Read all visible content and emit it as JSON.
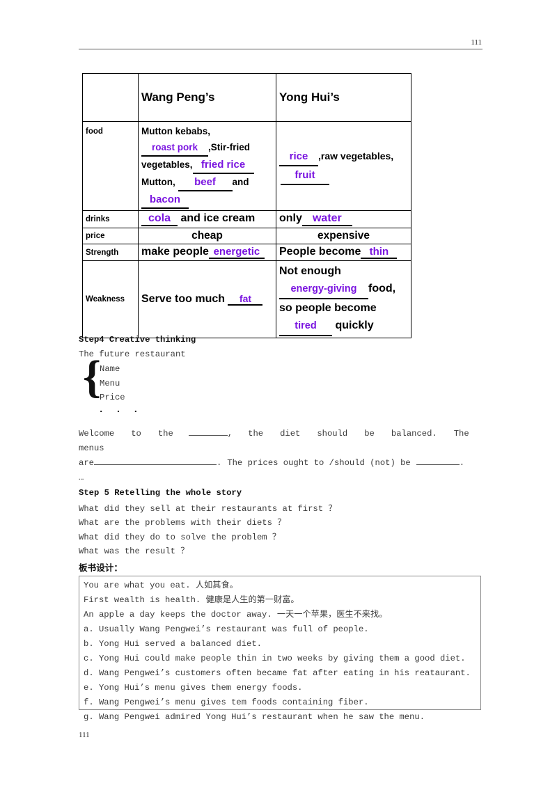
{
  "header": {
    "page_number": "111"
  },
  "footer": {
    "page_number": "111"
  },
  "table": {
    "headers": {
      "blank": "",
      "col2": "Wang Peng’s",
      "col3": "Yong Hui’s"
    },
    "rows": [
      {
        "label": "food",
        "wangpeng": {
          "l1": "Mutton kebabs,",
          "l2_blank": "roast pork",
          "l2_rest": ",Stir-fried",
          "l3_pre": "vegetables,",
          "l3_blank": "fried rice",
          "l4_pre": "Mutton,",
          "l4_blank": "beef",
          "l4_post": "and",
          "l5_blank": "bacon"
        },
        "yonghui": {
          "l1_blank": "rice",
          "l1_rest": ",raw vegetables,",
          "l2_blank": "fruit"
        }
      },
      {
        "label": "drinks",
        "wangpeng": {
          "blank": "cola",
          "rest": "and ice cream"
        },
        "yonghui": {
          "pre": "only",
          "blank": "water"
        }
      },
      {
        "label": "price",
        "wangpeng": {
          "value": "cheap"
        },
        "yonghui": {
          "value": "expensive"
        }
      },
      {
        "label": "Strength",
        "wangpeng": {
          "pre": "make people",
          "blank": "energetic"
        },
        "yonghui": {
          "pre": "People become",
          "blank": "thin"
        }
      },
      {
        "label": "Weakness",
        "wangpeng": {
          "pre": "Serve too much",
          "blank": "fat"
        },
        "yonghui": {
          "l1": "Not enough",
          "l2_blank": "energy-giving",
          "l2_rest": "food,",
          "l3": "so people become",
          "l4_blank": "tired",
          "l4_rest": "quickly"
        }
      }
    ]
  },
  "step4": {
    "title": "Step4 Creative thinking",
    "subtitle": "The future restaurant",
    "brace_glyph": "{",
    "brace_items": [
      "Name",
      "Menu",
      "Price"
    ],
    "brace_dots": "· · ·",
    "sentence": {
      "p1": "Welcome",
      "p2": "to",
      "p3": "the",
      "p4": ",",
      "p5": "the",
      "p6": "diet",
      "p7": "should",
      "p8": "be",
      "p9": "balanced.",
      "p10": "The",
      "p11": "menus",
      "p12": "are",
      "p13": ".",
      "p14": "The",
      "p15": "prices",
      "p16": "ought",
      "p17": "to",
      "p18": "/should",
      "p19": "(not)",
      "p20": "be",
      "p21": "."
    },
    "ellipsis": "…"
  },
  "step5": {
    "title": "Step 5 Retelling the whole story",
    "questions": [
      "What did they sell at their restaurants at first ？",
      "What are the problems with their diets ？",
      "What did they do to solve the problem ？",
      "What was the result ？"
    ]
  },
  "blackboard": {
    "title": "板书设计：",
    "lines": [
      "You are what you eat. 人如其食。",
      "First wealth is health.  健康是人生的第一财富。",
      "An apple a day keeps the doctor away. 一天一个苹果，医生不来找。",
      "a. Usually Wang Pengwei’s restaurant was full of people.",
      "b. Yong Hui served a balanced diet.",
      "c. Yong Hui could make people thin in two weeks by giving them a good diet.",
      "d. Wang Pengwei’s customers often became fat after eating in his reataurant.",
      "e. Yong Hui’s menu gives them energy foods.",
      "f. Wang Pengwei’s menu gives tem foods containing fiber.",
      "g. Wang Pengwei admired Yong Hui’s restaurant when he saw the menu."
    ]
  },
  "colors": {
    "highlight": "#7a14e0",
    "text": "#3a3a3a",
    "rule": "#555555"
  }
}
